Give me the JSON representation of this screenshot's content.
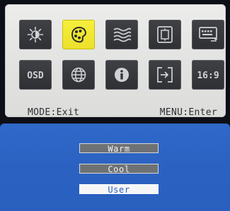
{
  "osd": {
    "icons": [
      {
        "name": "brightness-icon",
        "selected": false
      },
      {
        "name": "color-temperature-icon",
        "selected": true
      },
      {
        "name": "image-adjust-icon",
        "selected": false
      },
      {
        "name": "position-icon",
        "selected": false
      },
      {
        "name": "input-select-icon",
        "selected": false
      },
      {
        "name": "osd-settings-icon",
        "selected": false
      },
      {
        "name": "language-icon",
        "selected": false
      },
      {
        "name": "information-icon",
        "selected": false
      },
      {
        "name": "reset-icon",
        "selected": false
      },
      {
        "name": "aspect-ratio-icon",
        "selected": false
      }
    ],
    "osd_label": "OSD",
    "aspect_label": "16:9",
    "hint_left": "MODE:Exit",
    "hint_right": "MENU:Enter"
  },
  "menu": {
    "options": [
      {
        "label": "Warm",
        "state": "normal"
      },
      {
        "label": "Cool",
        "state": "normal"
      },
      {
        "label": "User",
        "state": "highlighted"
      }
    ]
  },
  "colors": {
    "panel_blue": "#2a5fbd",
    "selected_tile": "#f0e52f",
    "tile_dark": "#36383c"
  }
}
